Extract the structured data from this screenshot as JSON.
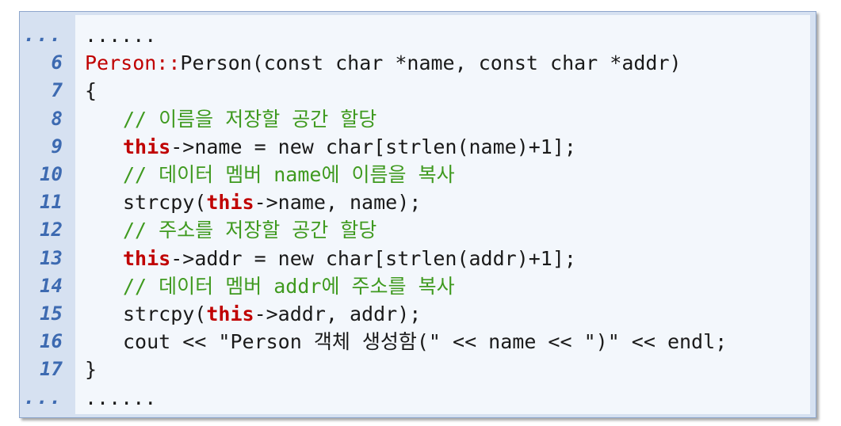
{
  "code_listing": {
    "lines": [
      {
        "number": "...",
        "segments": [
          {
            "text": "......",
            "style": "plain"
          }
        ]
      },
      {
        "number": "6",
        "segments": [
          {
            "text": "Person::",
            "style": "cls"
          },
          {
            "text": "Person(const char *name, const char *addr)",
            "style": "plain"
          }
        ]
      },
      {
        "number": "7",
        "segments": [
          {
            "text": "{",
            "style": "plain"
          }
        ]
      },
      {
        "number": "8",
        "indent": 1,
        "segments": [
          {
            "text": "// 이름을 저장할 공간 할당",
            "style": "cm"
          }
        ]
      },
      {
        "number": "9",
        "indent": 1,
        "segments": [
          {
            "text": "this",
            "style": "kw"
          },
          {
            "text": "->name = new char[strlen(name)+1];",
            "style": "plain"
          }
        ]
      },
      {
        "number": "10",
        "indent": 1,
        "segments": [
          {
            "text": "// 데이터 멤버 name에 이름을 복사",
            "style": "cm"
          }
        ]
      },
      {
        "number": "11",
        "indent": 1,
        "segments": [
          {
            "text": "strcpy(",
            "style": "plain"
          },
          {
            "text": "this",
            "style": "kw"
          },
          {
            "text": "->name, name);",
            "style": "plain"
          }
        ]
      },
      {
        "number": "12",
        "indent": 1,
        "segments": [
          {
            "text": "// 주소를 저장할 공간 할당",
            "style": "cm"
          }
        ]
      },
      {
        "number": "13",
        "indent": 1,
        "segments": [
          {
            "text": "this",
            "style": "kw"
          },
          {
            "text": "->addr = new char[strlen(addr)+1];",
            "style": "plain"
          }
        ]
      },
      {
        "number": "14",
        "indent": 1,
        "segments": [
          {
            "text": "// 데이터 멤버 addr에 주소를 복사",
            "style": "cm"
          }
        ]
      },
      {
        "number": "15",
        "indent": 1,
        "segments": [
          {
            "text": "strcpy(",
            "style": "plain"
          },
          {
            "text": "this",
            "style": "kw"
          },
          {
            "text": "->addr, addr);",
            "style": "plain"
          }
        ]
      },
      {
        "number": "16",
        "indent": 1,
        "segments": [
          {
            "text": "cout << \"Person 객체 생성함(\" << name << \")\" << endl;",
            "style": "plain"
          }
        ]
      },
      {
        "number": "17",
        "segments": [
          {
            "text": "}",
            "style": "plain"
          }
        ]
      },
      {
        "number": "...",
        "segments": [
          {
            "text": "......",
            "style": "plain"
          }
        ]
      }
    ]
  },
  "colors": {
    "frame_background": "#d6e1f1",
    "code_background": "#f3f7fc",
    "line_number": "#3d6ab1",
    "keyword": "#c00000",
    "comment": "#3f9a1f",
    "text": "#1a1a1a"
  }
}
